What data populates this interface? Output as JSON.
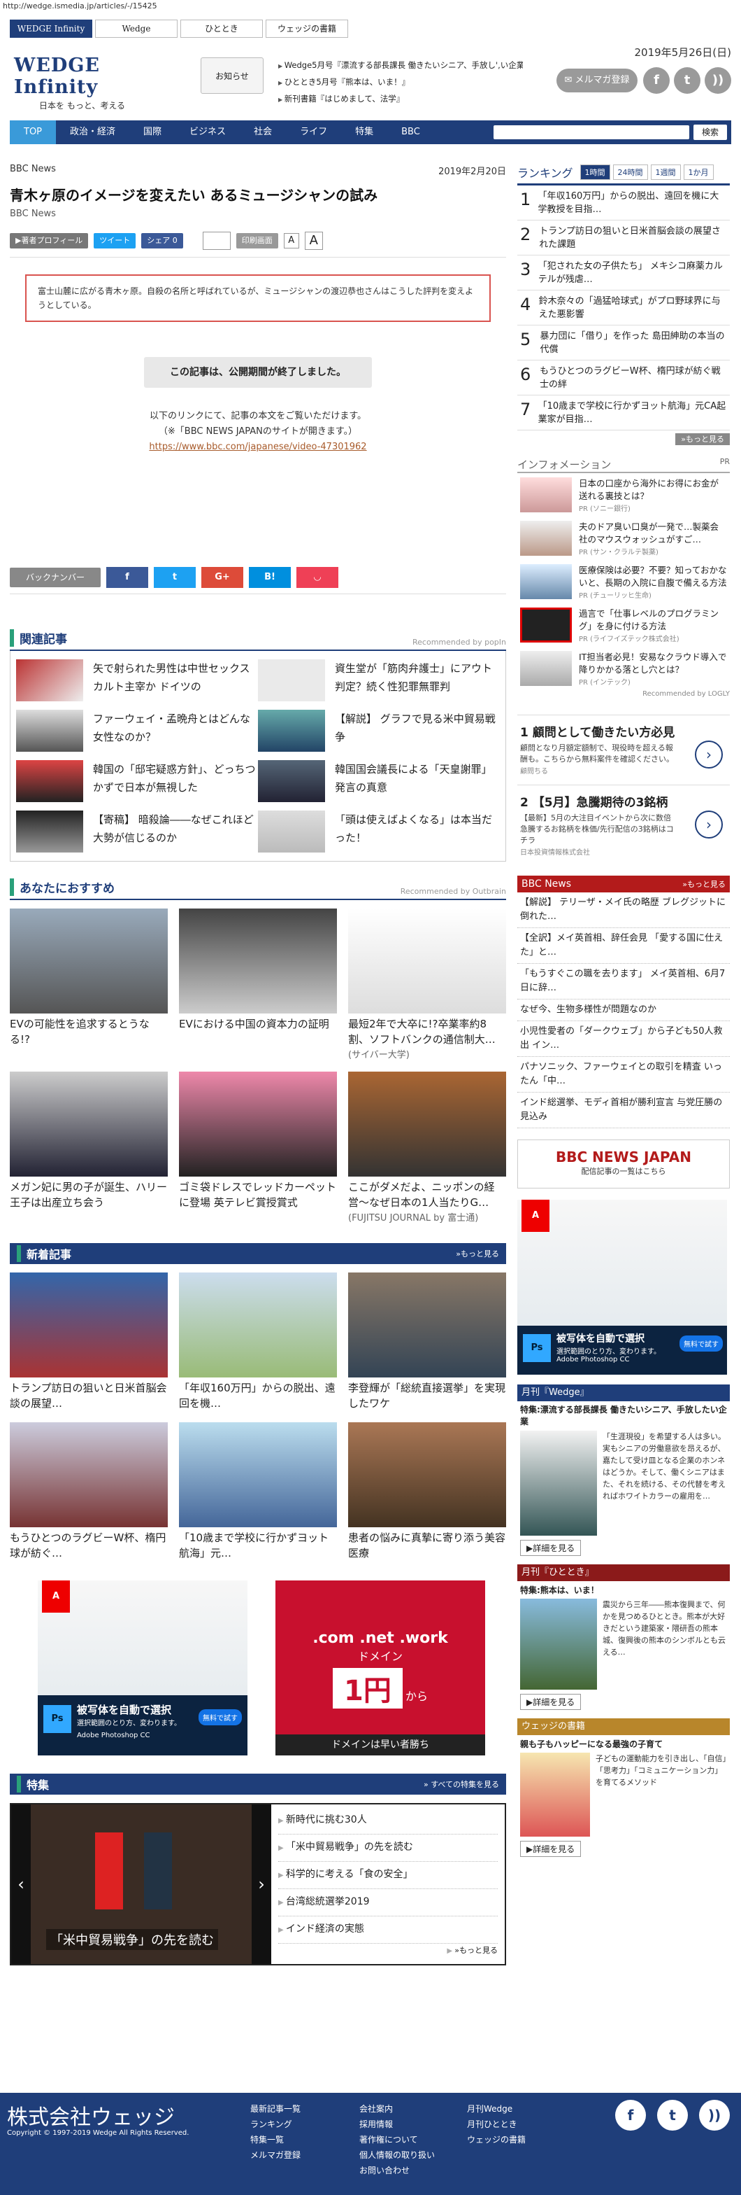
{
  "url": "http://wedge.ismedia.jp/articles/-/15425",
  "topnav": [
    "WEDGE Infinity",
    "Wedge",
    "ひととき",
    "ウェッジの書籍"
  ],
  "date": "2019年5月26日(日)",
  "logo": {
    "title": "WEDGE Infinity",
    "tagline": "日本を もっと、考える"
  },
  "oshirase": "お知らせ",
  "news_lines": [
    "Wedge5月号『漂流する部長課長 働きたいシニア、手放し',い企業』",
    "ひととき5月号『熊本は、いま！』",
    "新刊書籍『はじめまして、法学』"
  ],
  "mail_button": "✉ メルマガ登録",
  "nav": [
    "TOP",
    "政治・経済",
    "国際",
    "ビジネス",
    "社会",
    "ライフ",
    "特集",
    "BBC"
  ],
  "search_button": "検索",
  "article": {
    "source": "BBC News",
    "date": "2019年2月20日",
    "title": "青木ヶ原のイメージを変えたい あるミュージシャンの試み",
    "byline": "BBC News",
    "author_btn": "▶著者プロフィール",
    "tweet": "ツイート",
    "share": "シェア 0",
    "print": "印刷画面",
    "lead": "富士山麓に広がる青木ヶ原。自殺の名所と呼ばれているが、ミュージシャンの渡辺恭也さんはこうした評判を変えようとしている。",
    "expired": "この記事は、公開期間が終了しました。",
    "link_lines": [
      "以下のリンクにて、記事の本文をご覧いただけます。",
      "（※「BBC NEWS JAPANのサイトが開きます。）"
    ],
    "link_url": "https://www.bbc.com/japanese/video-47301962",
    "backnumber": "バックナンバー"
  },
  "related": {
    "title": "関連記事",
    "recommended": "Recommended by popIn",
    "items": [
      "矢で射られた男性は中世セックスカルト主宰か ドイツの",
      "資生堂が「筋肉弁護士」にアウト判定？続く性犯罪無罪判",
      "ファーウェイ・孟晩舟とはどんな女性なのか？",
      "【解説】 グラフで見る米中貿易戦争",
      "韓国の「邸宅疑惑方針」、どっちつかずで日本が無視した",
      "韓国国会議長による「天皇謝罪」発言の真意",
      "【寄稿】 暗殺論――なぜこれほど大勢が信じるのか",
      "「頭は使えばよくなる」は本当だった！"
    ]
  },
  "recommend": {
    "title": "あなたにおすすめ",
    "recommended": "Recommended by Outbrain",
    "items": [
      {
        "text": "EVの可能性を追求するとうなる!?",
        "src": ""
      },
      {
        "text": "EVにおける中国の資本力の証明",
        "src": ""
      },
      {
        "text": "最短2年で大卒に!?卒業率約8割、ソフトバンクの通信制大…",
        "src": "(サイバー大学)"
      },
      {
        "text": "メガン妃に男の子が誕生、ハリー王子は出産立ち会う",
        "src": ""
      },
      {
        "text": "ゴミ袋ドレスでレッドカーペットに登場 英テレビ賞授賞式",
        "src": ""
      },
      {
        "text": "ここがダメだよ、ニッポンの経営〜なぜ日本の1人当たりG…",
        "src": "(FUJITSU JOURNAL by 富士通)"
      }
    ]
  },
  "newest": {
    "title": "新着記事",
    "more": "»もっと見る",
    "items": [
      "トランプ訪日の狙いと日米首脳会談の展望…",
      "「年収160万円」からの脱出、遠回を機…",
      "李登輝が「総統直接選挙」を実現したワケ",
      "もうひとつのラグビーW杯、楕円球が紡ぐ…",
      "「10歳まで学校に行かずヨット航海」元…",
      "患者の悩みに真摯に寄り添う美容医療"
    ]
  },
  "ads": {
    "adobe_lines": [
      "被写体を自動で選択",
      "選択範囲のとり方、変わります。",
      "Adobe Photoshop CC"
    ],
    "adobe_btn": "無料で試す",
    "onamae_lines": [
      ".com .net .work",
      "ドメイン",
      "1円",
      "から",
      "ドメインは早い者勝ち"
    ]
  },
  "tokushu": {
    "title": "特集",
    "more": "» すべての特集を見る",
    "caption": "「米中貿易戦争」の先を読む",
    "items": [
      "新時代に挑む30人",
      "「米中貿易戦争」の先を読む",
      "科学的に考える「食の安全」",
      "台湾総統選挙2019",
      "インド経済の実態"
    ],
    "more2": "»もっと見る"
  },
  "ranking": {
    "title": "ランキング",
    "tabs": [
      "1時間",
      "24時間",
      "1週間",
      "1か月"
    ],
    "items": [
      "「年収160万円」からの脱出、遠回を機に大学教授を目指…",
      "トランプ訪日の狙いと日米首脳会談の展望された課題",
      "「犯された女の子供たち」 メキシコ麻薬カルテルが残虐…",
      "鈴木奈々の「過猛哈球式」がプロ野球界に与えた悪影響",
      "暴力団に「借り」を作った 島田紳助の本当の代償",
      "もうひとつのラグビーW杯、楕円球が紡ぐ戦士の絆",
      "「10歳まで学校に行かずヨット航海」元CA起業家が目指…"
    ],
    "more": "»もっと見る"
  },
  "information": {
    "title": "インフォメーション",
    "pr": "PR",
    "items": [
      {
        "text": "日本の口座から海外にお得にお金が送れる裏技とは？",
        "pr": "PR (ソニー銀行)"
      },
      {
        "text": "夫のドア臭い口臭が一発で…製薬会社のマウスウォッシュがすご…",
        "pr": "PR (サン・クラルテ製薬)"
      },
      {
        "text": "医療保険は必要？不要？知っておかないと、長期の入院に自腹で備える方法",
        "pr": "PR (チューリッヒ生命)"
      },
      {
        "text": "過言で「仕事レベルのプログラミング」を身に付ける方法",
        "pr": "PR (ライフイズテック株式会社)"
      },
      {
        "text": "IT担当者必見！安易なクラウド導入で降りかかる落とし穴とは？",
        "pr": "PR (インテック)"
      }
    ],
    "recommended": "Recommended by LOGLY"
  },
  "side_ads": [
    {
      "num": "1",
      "title": "顧問として働きたい方必見",
      "desc": "顧問となり月額定額制で、現役時を超える報酬も。こちらから無料案件を確認ください。",
      "src": "顧問ちる"
    },
    {
      "num": "2",
      "title": "【5月】急騰期待の3銘柄",
      "desc": "【最新】5月の大注目イベントから次に数倍急騰するお銘柄を株価/先行配信の3銘柄はコチラ",
      "src": "日本投資情報株式会社"
    }
  ],
  "bbc": {
    "title": "BBC News",
    "more": "»もっと見る",
    "items": [
      "【解説】 テリーザ・メイ氏の略歴 ブレグジットに倒れた…",
      "【全訳】メイ英首相、辞任会見 「愛する国に仕えた」と…",
      "「もうすぐこの職を去ります」 メイ英首相、6月7日に辞…",
      "なぜ今、生物多様性が問題なのか",
      "小児性愛者の「ダークウェブ」から子ども50人救出 イン…",
      "パナソニック、ファーウェイとの取引を精査 いったん「中…",
      "インド総選挙、モディ首相が勝利宣言 与党圧勝の見込み"
    ],
    "banner": "BBC NEWS JAPAN",
    "banner_sub": "配信記事の一覧はこちら"
  },
  "monthly_wedge": {
    "header": "月刊『Wedge』",
    "title": "特集:漂流する部長課長 働きたいシニア、手放したい企業",
    "body": "「生涯現役」を希望する人は多い。実もシニアの労働意欲を昂えるが、嘉たして受け皿となる企業のホンネはどうか。そして、働くシニアはまた、それを続ける、その代替を考えればホワイトカラーの雇用を…",
    "btn": "▶詳細を見る"
  },
  "monthly_hitotoki": {
    "header": "月刊『ひととき』",
    "title": "特集:熊本は、いま！",
    "body": "震災から三年――熊本復興まで、何かを見つめるひととき。熊本が大好きだという建築家・隈研吾の熊本城、復興後の熊本のシンボルとも云える…",
    "btn": "▶詳細を見る"
  },
  "books": {
    "header": "ウェッジの書籍",
    "title": "親も子もハッピーになる最強の子育て",
    "body": "子どもの運動能力を引き出し、「自信」「思考力」「コミュニケーション力」を育てるメソッド",
    "btn": "▶詳細を見る"
  },
  "footer": {
    "company": "株式会社ウェッジ",
    "copyright": "Copyright © 1997-2019 Wedge All Rights Reserved.",
    "col1": [
      "最新記事一覧",
      "ランキング",
      "特集一覧",
      "メルマガ登録"
    ],
    "col2": [
      "会社案内",
      "採用情報",
      "著作権について",
      "個人情報の取り扱い",
      "お問い合わせ"
    ],
    "col3": [
      "月刊Wedge",
      "月刊ひととき",
      "ウェッジの書籍"
    ]
  },
  "colors": {
    "navy": "#1f3e7a",
    "accent": "#3a9ad9",
    "bbc_red": "#b31b1b",
    "green": "#2aa07a"
  }
}
